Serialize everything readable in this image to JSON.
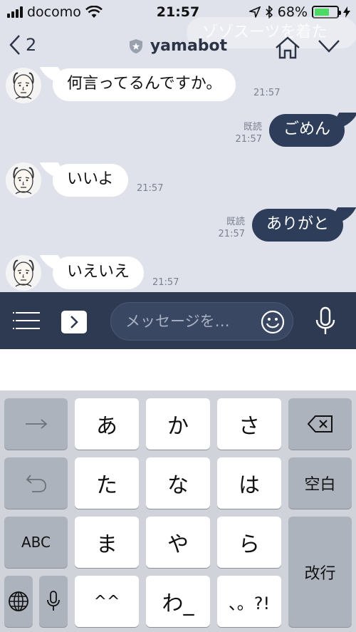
{
  "status_bar": {
    "carrier": "docomo",
    "time": "21:57",
    "battery_percent": "68%",
    "battery_level": 0.68
  },
  "banner_preview": "ゾゾスーツを着た",
  "header": {
    "back_count": "2",
    "title": "yamabot"
  },
  "messages": [
    {
      "side": "in",
      "text": "何言ってるんですか。",
      "time": "21:57"
    },
    {
      "side": "out",
      "text": "ごめん",
      "read": "既読",
      "time": "21:57"
    },
    {
      "side": "in",
      "text": "いいよ",
      "time": "21:57"
    },
    {
      "side": "out",
      "text": "ありがと",
      "read": "既読",
      "time": "21:57"
    },
    {
      "side": "in",
      "text": "いえいえ",
      "time": "21:57"
    }
  ],
  "input": {
    "placeholder": "メッセージを…"
  },
  "keyboard": {
    "row1": [
      "あ",
      "か",
      "さ"
    ],
    "row2": [
      "た",
      "な",
      "は"
    ],
    "row3": [
      "ま",
      "や",
      "ら"
    ],
    "row4": [
      "^^",
      "わ_",
      "、。?!"
    ],
    "abc": "ABC",
    "space": "空白",
    "return": "改行"
  }
}
